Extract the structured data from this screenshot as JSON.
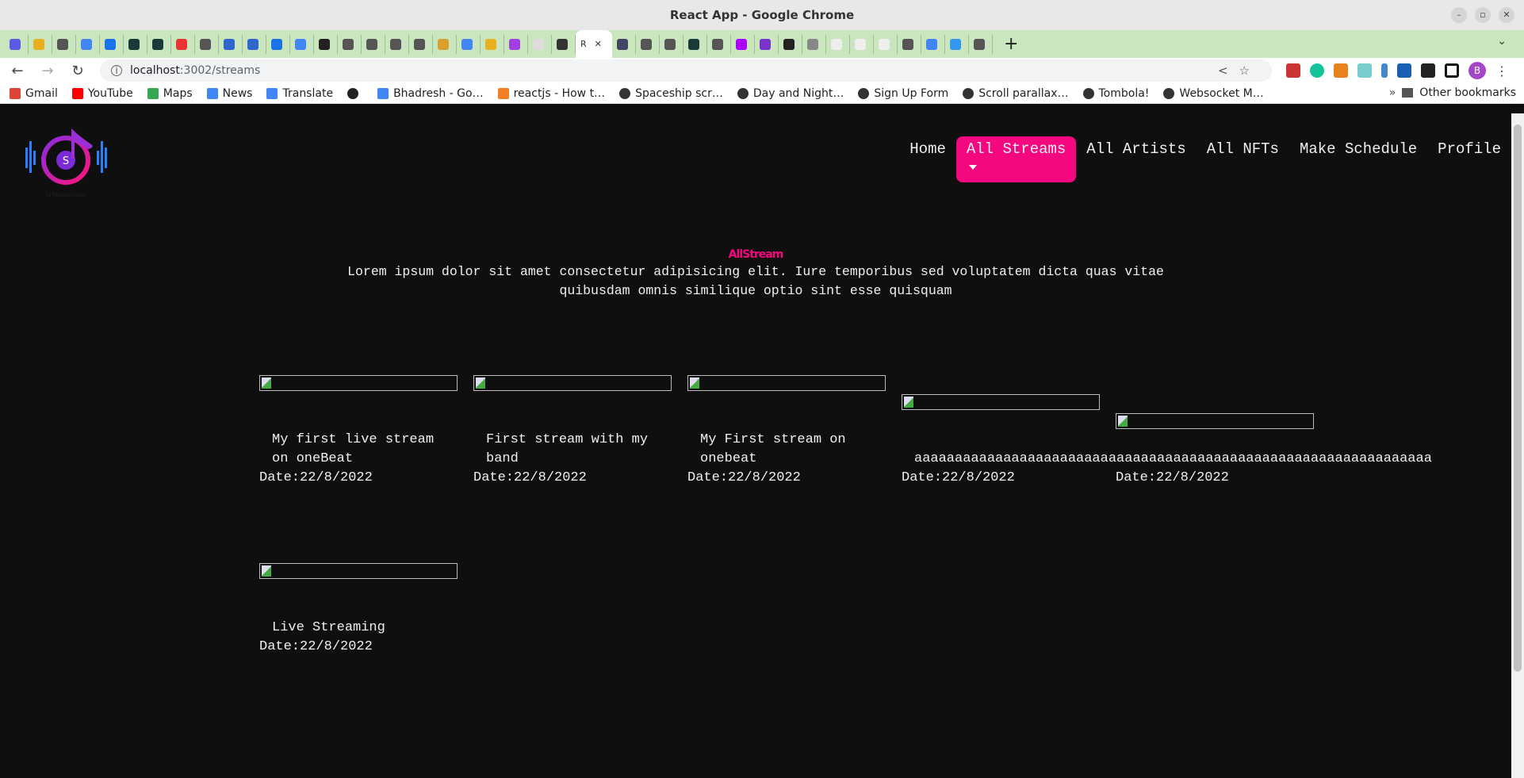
{
  "browser": {
    "window_title": "React App - Google Chrome",
    "active_tab_label": "R",
    "url_host": "localhost",
    "url_path": ":3002/streams",
    "bookmarks": [
      "Gmail",
      "YouTube",
      "Maps",
      "News",
      "Translate",
      "",
      "Bhadresh - Go…",
      "reactjs - How t…",
      "Spaceship scr…",
      "Day and Night…",
      "Sign Up Form",
      "Scroll parallax…",
      "Tombola!",
      "Websocket M…"
    ],
    "other_bookmarks": "Other bookmarks",
    "profile_initial": "B"
  },
  "nav": {
    "items": [
      "Home",
      "All Streams",
      "All Artists",
      "All NFTs",
      "Make Schedule",
      "Profile"
    ],
    "active": "All Streams",
    "accent": "#f4077f"
  },
  "hero": {
    "title": "AllStream",
    "description": "Lorem ipsum dolor sit amet consectetur adipisicing elit. Iure temporibus sed voluptatem dicta quas vitae quibusdam omnis similique optio sint esse quisquam"
  },
  "streams": [
    {
      "title": "My first live stream on oneBeat",
      "date": "Date:22/8/2022"
    },
    {
      "title": "First stream with my band",
      "date": "Date:22/8/2022"
    },
    {
      "title": "My First stream on onebeat",
      "date": "Date:22/8/2022"
    },
    {
      "title": "aaaaaaaaaaaaaaaaaaaaaaaaaaaaaaaaaaaaaaaaaaaaaaaaaaaaaaaaaaaaaaaa",
      "date": "Date:22/8/2022"
    },
    {
      "title": "",
      "date": "Date:22/8/2022"
    },
    {
      "title": "Live Streaming",
      "date": "Date:22/8/2022"
    }
  ]
}
